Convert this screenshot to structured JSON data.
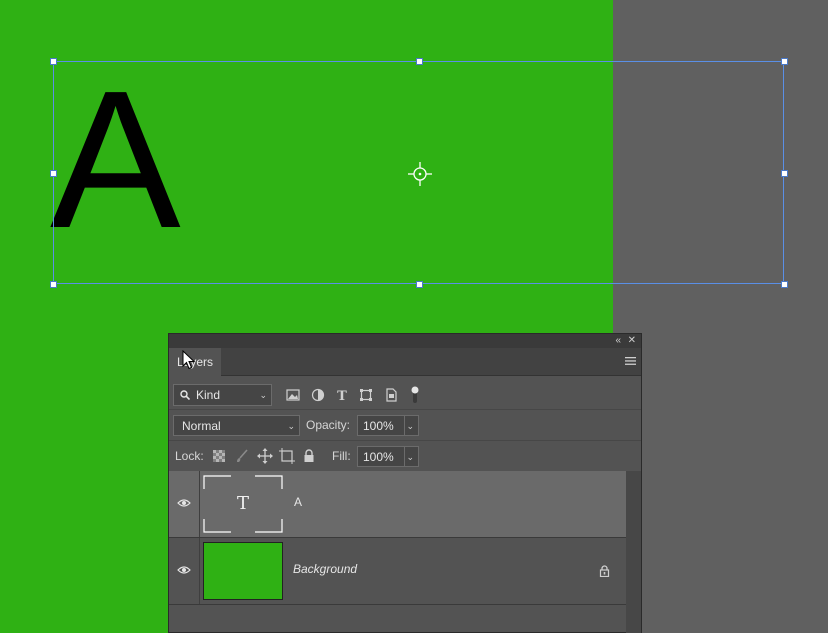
{
  "canvas": {
    "layer_text": "A",
    "background_color": "#2fb114",
    "pasteboard_color": "#606060",
    "selection_color": "#5a8fe6"
  },
  "panel": {
    "title": "Layers",
    "collapse_icon": "double-chevron-left-icon",
    "close_icon": "close-icon",
    "menu_icon": "hamburger-menu-icon",
    "filter": {
      "kind_label": "Kind",
      "icons": [
        "image-filter-icon",
        "adjustment-filter-icon",
        "type-filter-icon",
        "shape-filter-icon",
        "smart-object-filter-icon",
        "filter-toggle-icon"
      ]
    },
    "blend_mode": "Normal",
    "opacity_label": "Opacity:",
    "opacity_value": "100%",
    "lock_label": "Lock:",
    "lock_icons": [
      "lock-transparent-icon",
      "lock-paint-icon",
      "lock-position-icon",
      "lock-artboard-icon",
      "lock-all-icon"
    ],
    "fill_label": "Fill:",
    "fill_value": "100%",
    "layers": [
      {
        "name": "A",
        "type": "text",
        "thumb_glyph": "T",
        "visible": true,
        "selected": true
      },
      {
        "name": "Background",
        "type": "pixel",
        "visible": true,
        "locked": true,
        "thumb_color": "#2fb114"
      }
    ]
  }
}
